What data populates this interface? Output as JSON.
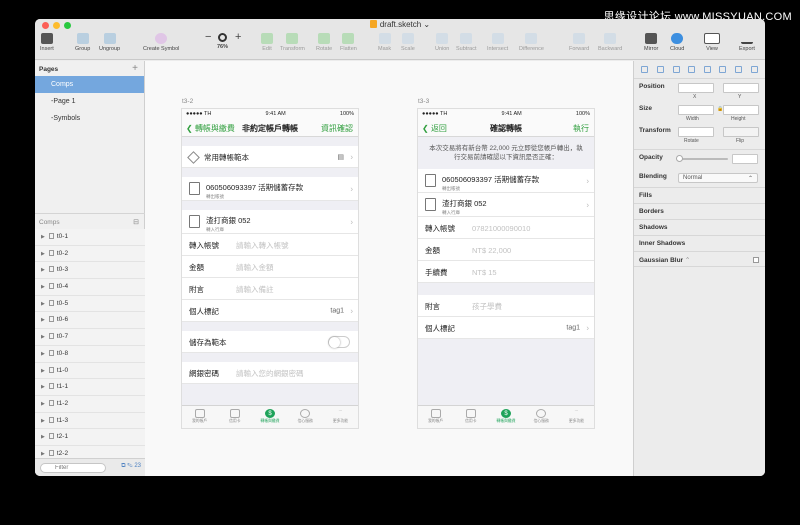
{
  "watermark": "思缘设计论坛 www.MISSYUAN.COM",
  "window": {
    "title": "draft.sketch"
  },
  "toolbar": {
    "insert": "Insert",
    "group": "Group",
    "ungroup": "Ungroup",
    "create_symbol": "Create Symbol",
    "zoom_minus": "−",
    "zoom_plus": "+",
    "zoom": "76%",
    "edit": "Edit",
    "transform": "Transform",
    "rotate": "Rotate",
    "flatten": "Flatten",
    "mask": "Mask",
    "scale": "Scale",
    "union": "Union",
    "subtract": "Subtract",
    "intersect": "Intersect",
    "difference": "Difference",
    "forward": "Forward",
    "backward": "Backward",
    "mirror": "Mirror",
    "cloud": "Cloud",
    "view": "View",
    "export": "Export"
  },
  "sidebar": {
    "pages_header": "Pages",
    "add": "+",
    "pages": [
      "Comps",
      "-Page 1",
      "-Symbols"
    ],
    "comps_header": "Comps",
    "layers": [
      "t0-1",
      "t0-2",
      "t0-3",
      "t0-4",
      "t0-5",
      "t0-6",
      "t0-7",
      "t0-8",
      "t1-0",
      "t1-1",
      "t1-2",
      "t1-3",
      "t2-1",
      "t2-2"
    ],
    "filter_placeholder": "Filter",
    "filter_count": "23"
  },
  "artboard1": {
    "label": "t3-2",
    "status": {
      "carrier": "●●●●● TH",
      "time": "9:41 AM",
      "battery": "100%"
    },
    "nav": {
      "back": "轉帳與繳費",
      "title": "非約定帳戶轉帳",
      "right": "資訊確認"
    },
    "template": "常用轉帳範本",
    "source": {
      "account": "060506093397 活期儲蓄存款",
      "sub": "轉出帳號"
    },
    "bank": {
      "name": "渣打商銀 052",
      "sub": "轉入行庫"
    },
    "fields": [
      {
        "label": "轉入帳號",
        "placeholder": "請輸入轉入帳號"
      },
      {
        "label": "金額",
        "placeholder": "請輸入金額"
      },
      {
        "label": "附言",
        "placeholder": "請輸入備註"
      }
    ],
    "tag": {
      "label": "個人標記",
      "value": "tag1"
    },
    "save": "儲存為範本",
    "password": {
      "label": "網銀密碼",
      "placeholder": "請輸入您的網銀密碼"
    }
  },
  "artboard2": {
    "label": "t3-3",
    "status": {
      "carrier": "●●●●● TH",
      "time": "9:41 AM",
      "battery": "100%"
    },
    "nav": {
      "back": "返回",
      "title": "確認轉帳",
      "right": "執行"
    },
    "notice": "本次交易將有新台幣 22,000 元立即從您帳戶轉出，執行交易前請確認以下資訊是否正確：",
    "source": {
      "account": "060506093397 活期儲蓄存款",
      "sub": "轉出帳號"
    },
    "bank": {
      "name": "渣打商銀 052",
      "sub": "轉入行庫"
    },
    "fields": [
      {
        "label": "轉入帳號",
        "value": "07821000090010"
      },
      {
        "label": "金額",
        "value": "NT$ 22,000"
      },
      {
        "label": "手續費",
        "value": "NT$ 15"
      }
    ],
    "memo": {
      "label": "附言",
      "value": "孩子學費"
    },
    "tag": {
      "label": "個人標記",
      "value": "tag1"
    }
  },
  "tabbar": [
    "我的帳戶",
    "信用卡",
    "轉帳與繳費",
    "信心服務",
    "更多功能"
  ],
  "inspector": {
    "position": "Position",
    "x": "X",
    "y": "Y",
    "size": "Size",
    "width": "Width",
    "height": "Height",
    "transform": "Transform",
    "rotate": "Rotate",
    "flip": "Flip",
    "opacity": "Opacity",
    "blending": "Blending",
    "blending_value": "Normal",
    "fills": "Fills",
    "borders": "Borders",
    "shadows": "Shadows",
    "inner_shadows": "Inner Shadows",
    "gaussian_blur": "Gaussian Blur"
  }
}
